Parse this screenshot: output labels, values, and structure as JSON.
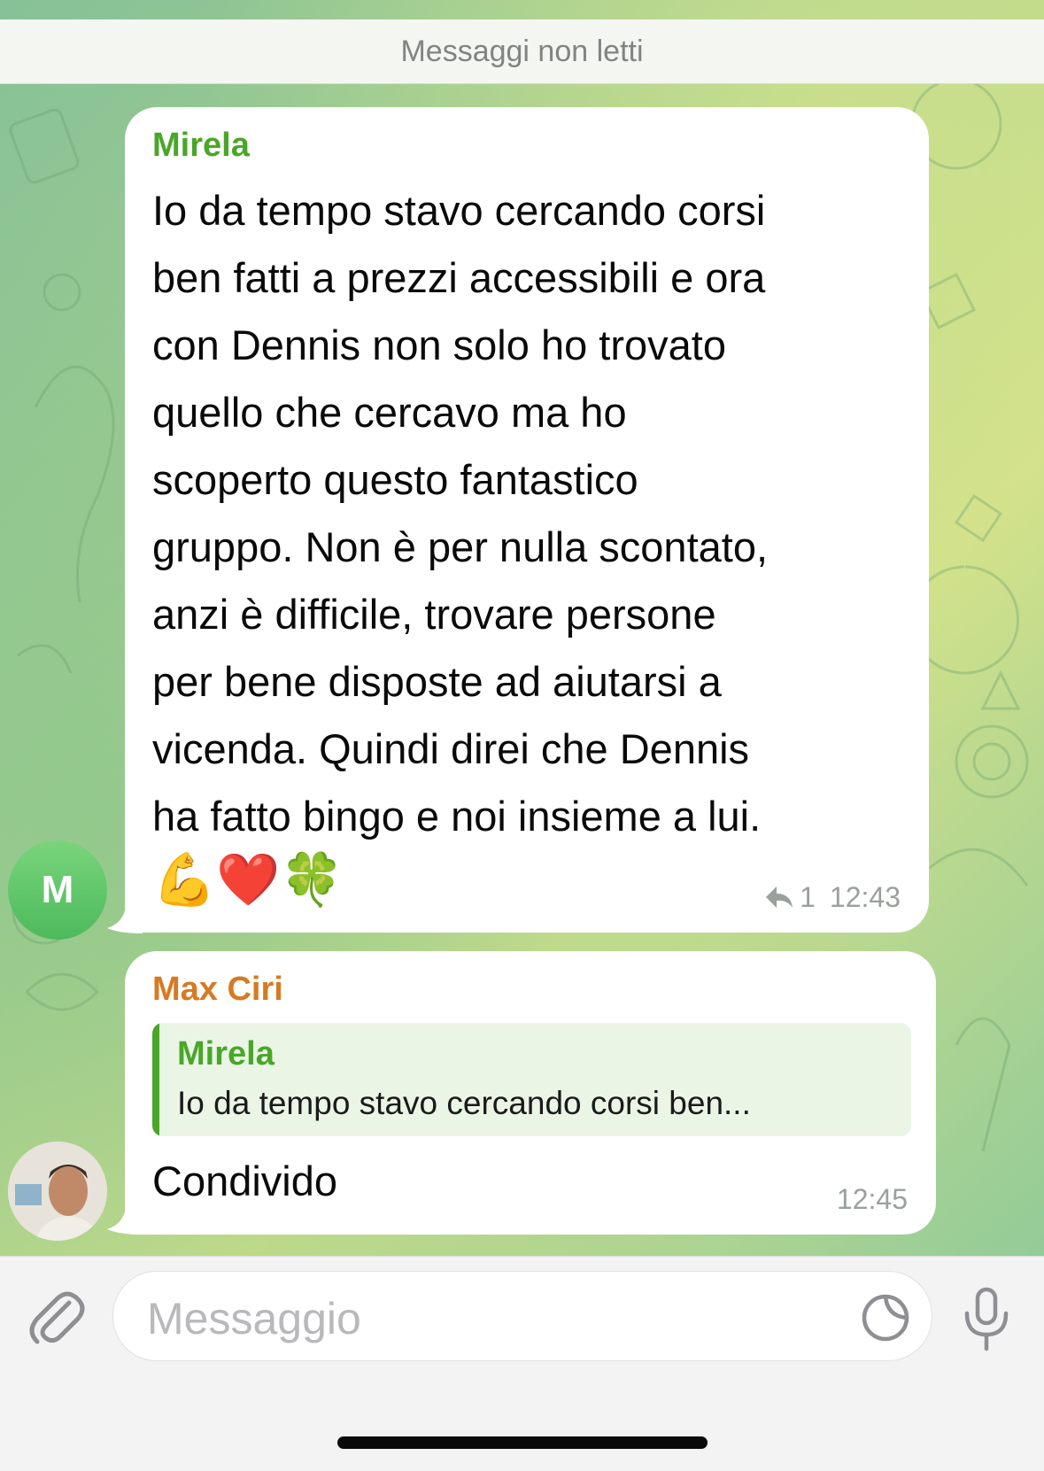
{
  "unread_divider": "Messaggi non letti",
  "messages": [
    {
      "sender": "Mirela",
      "sender_color": "#4aa628",
      "avatar_initial": "M",
      "text_lines": [
        "Io da tempo stavo cercando corsi",
        "ben fatti a prezzi accessibili e ora",
        "con Dennis non solo ho trovato",
        "quello che cercavo ma ho",
        "scoperto questo fantastico",
        "gruppo. Non è per nulla scontato,",
        "anzi è difficile, trovare persone",
        "per bene disposte ad aiutarsi a",
        "vicenda. Quindi direi che Dennis",
        "ha fatto bingo e noi insieme a lui."
      ],
      "emoji": "💪❤️🍀",
      "reply_count": "1",
      "time": "12:43"
    },
    {
      "sender": "Max Ciri",
      "sender_color": "#d77a22",
      "reply_to": {
        "sender": "Mirela",
        "snippet": "Io da tempo stavo cercando corsi ben..."
      },
      "text": "Condivido",
      "time": "12:45"
    }
  ],
  "composer": {
    "placeholder": "Messaggio",
    "attach_icon": "paperclip-icon",
    "sticker_icon": "sticker-icon",
    "mic_icon": "microphone-icon"
  },
  "colors": {
    "quote_bar": "#4aa628",
    "quote_bg": "#eaf5e6",
    "avatar_green": "#5cc468"
  }
}
